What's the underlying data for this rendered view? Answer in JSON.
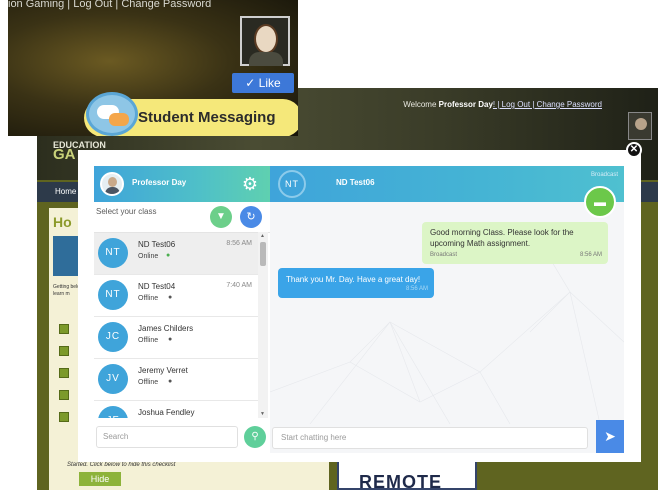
{
  "zoom_inset": {
    "top_links": "ion Gaming | Log Out | Change Password",
    "like_label": "✓ Like",
    "student_messaging": "Student Messaging"
  },
  "site": {
    "welcome_prefix": "Welcome ",
    "welcome_name": "Professor Day",
    "welcome_links": "! | Log Out | Change Password",
    "logo_top": "EDUCATION",
    "logo_bottom": "GA",
    "nav_home": "Home",
    "heading": "Ho",
    "blurb": "Getting below t learn m",
    "footer_text": "Started. Click below to hide this checklist",
    "hide_button": "Hide",
    "remote_logo": "REMOTE"
  },
  "chat": {
    "user_name": "Professor Day",
    "select_class_label": "Select your class",
    "search_placeholder": "Search",
    "contacts": [
      {
        "initials": "NT",
        "name": "ND Test06",
        "status": "Online",
        "time": "8:56 AM"
      },
      {
        "initials": "NT",
        "name": "ND Test04",
        "status": "Offline",
        "time": "7:40 AM"
      },
      {
        "initials": "JC",
        "name": "James Childers",
        "status": "Offline",
        "time": ""
      },
      {
        "initials": "JV",
        "name": "Jeremy Verret",
        "status": "Offline",
        "time": ""
      },
      {
        "initials": "JF",
        "name": "Joshua Fendley",
        "status": "",
        "time": ""
      }
    ],
    "active_chat": {
      "initials": "NT",
      "name": "ND Test06",
      "broadcast_label": "Broadcast"
    },
    "messages": [
      {
        "text": "Good morning Class. Please look for the upcoming Math assignment.",
        "tag": "Broadcast",
        "time": "8:56 AM",
        "direction": "out"
      },
      {
        "text": "Thank you Mr. Day. Have a great day!",
        "time": "8:56 AM",
        "direction": "in"
      }
    ],
    "input_placeholder": "Start chatting here",
    "colors": {
      "accent_blue": "#3fa4da",
      "accent_green": "#6cc84a",
      "online_dot": "#4caf50",
      "offline_dot": "#555555"
    }
  },
  "icons": {
    "gear": "gear-icon",
    "filter": "filter-icon",
    "refresh": "refresh-icon",
    "search": "search-icon",
    "send": "send-icon",
    "close": "close-icon",
    "message": "message-icon"
  }
}
